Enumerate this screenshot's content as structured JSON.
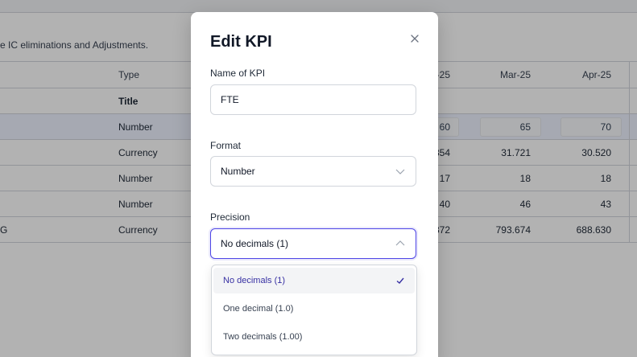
{
  "background": {
    "note": "e IC eliminations and Adjustments.",
    "table": {
      "headers": {
        "type": "Type",
        "feb": "-25",
        "mar": "Mar-25",
        "apr": "Apr-25"
      },
      "rows": [
        {
          "name": "",
          "type": "Title",
          "feb": "",
          "mar": "",
          "apr": ""
        },
        {
          "name": "",
          "type": "Number",
          "feb": "60",
          "mar": "65",
          "apr": "70"
        },
        {
          "name": "",
          "type": "Currency",
          "feb": "354",
          "mar": "31.721",
          "apr": "30.520"
        },
        {
          "name": "",
          "type": "Number",
          "feb": "17",
          "mar": "18",
          "apr": "18"
        },
        {
          "name": "",
          "type": "Number",
          "feb": "40",
          "mar": "46",
          "apr": "43"
        },
        {
          "name": "G",
          "type": "Currency",
          "feb": "372",
          "mar": "793.674",
          "apr": "688.630"
        }
      ]
    }
  },
  "modal": {
    "title": "Edit KPI",
    "name_field": {
      "label": "Name of KPI",
      "value": "FTE"
    },
    "format_field": {
      "label": "Format",
      "value": "Number"
    },
    "precision_field": {
      "label": "Precision",
      "value": "No decimals (1)",
      "options": [
        "No decimals (1)",
        "One decimal (1.0)",
        "Two decimals (1.00)"
      ],
      "selected_index": 0
    }
  },
  "colors": {
    "accent": "#4f46e5",
    "selected_text": "#3730a3"
  }
}
